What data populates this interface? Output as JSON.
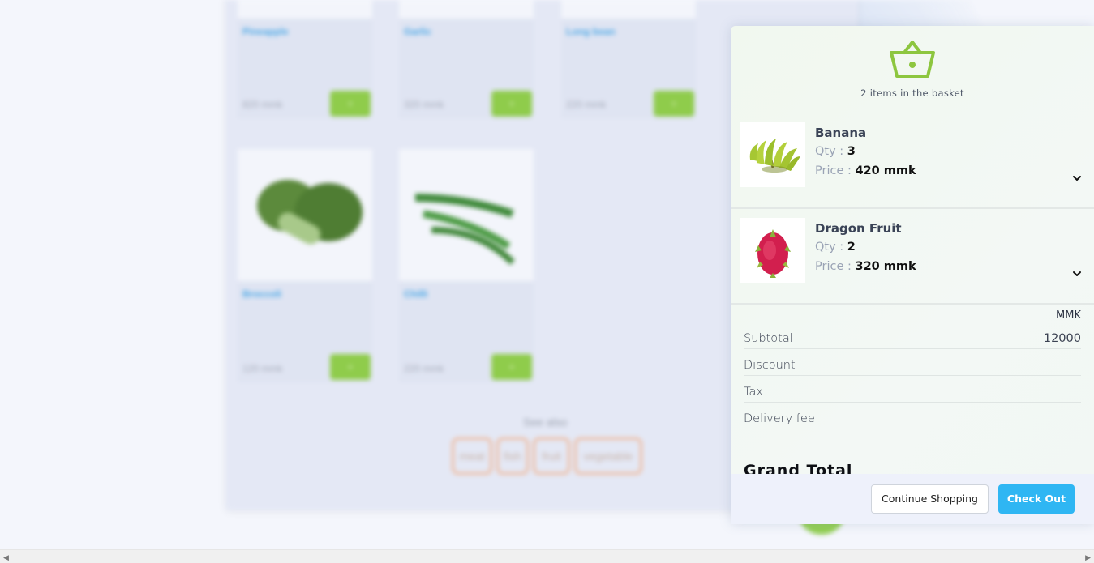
{
  "background": {
    "products": [
      {
        "name": "Pineapple",
        "price": "820",
        "unit": "mmk",
        "add_label": "+"
      },
      {
        "name": "Garlic",
        "price": "320",
        "unit": "mmk",
        "add_label": "+"
      },
      {
        "name": "Long bean",
        "price": "220",
        "unit": "mmk",
        "add_label": "+"
      },
      {
        "name": "Broccoli",
        "price": "120",
        "unit": "mmk",
        "add_label": "+"
      },
      {
        "name": "Chilli",
        "price": "220",
        "unit": "mmk",
        "add_label": "+"
      }
    ],
    "see_also_label": "See also",
    "tags": [
      "meat",
      "fish",
      "fruit",
      "vegetable"
    ]
  },
  "basket": {
    "count_text": "2 items in the basket",
    "items": [
      {
        "name": "Banana",
        "qty_label": "Qty :",
        "qty": "3",
        "price_label": "Price :",
        "price": "420 mmk"
      },
      {
        "name": "Dragon Fruit",
        "qty_label": "Qty :",
        "qty": "2",
        "price_label": "Price :",
        "price": "320 mmk"
      }
    ],
    "currency": "MMK",
    "subtotal_label": "Subtotal",
    "subtotal_value": "12000",
    "discount_label": "Discount",
    "tax_label": "Tax",
    "delivery_label": "Delivery fee",
    "grand_total_label": "Grand Total",
    "continue_label": "Continue Shopping",
    "checkout_label": "Check Out"
  },
  "colors": {
    "accent_green": "#8dc63f",
    "checkout_blue": "#2fb6f3",
    "link_blue": "#49a7e6"
  }
}
